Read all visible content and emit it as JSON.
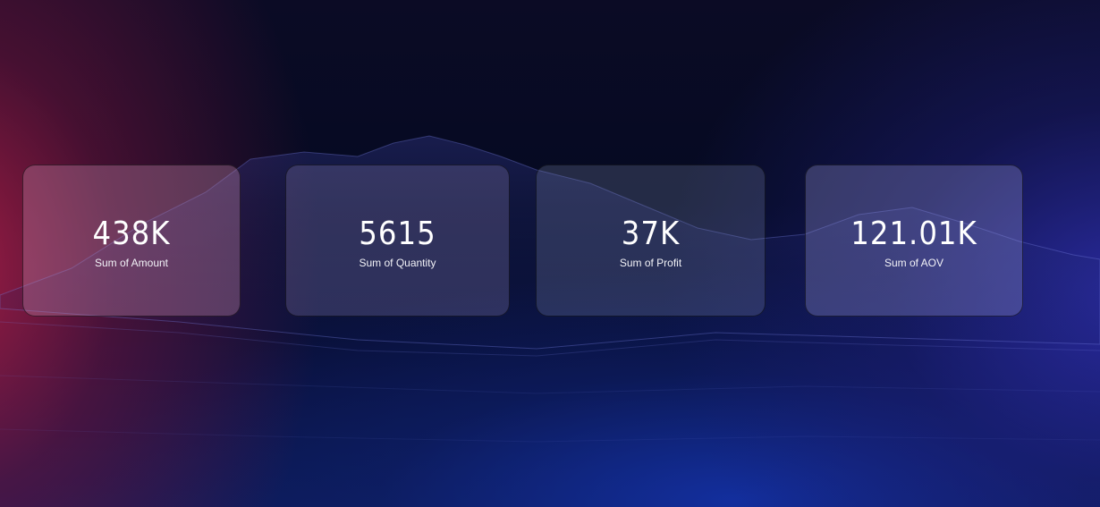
{
  "colors": {
    "background_dark": "#050a22",
    "accent_magenta": "#aa1e46",
    "accent_blue": "#2d2daa",
    "text": "#ffffff"
  },
  "cards": [
    {
      "value": "438K",
      "label": "Sum of Amount"
    },
    {
      "value": "5615",
      "label": "Sum of Quantity"
    },
    {
      "value": "37K",
      "label": "Sum of Profit"
    },
    {
      "value": "121.01K",
      "label": "Sum of AOV"
    }
  ]
}
